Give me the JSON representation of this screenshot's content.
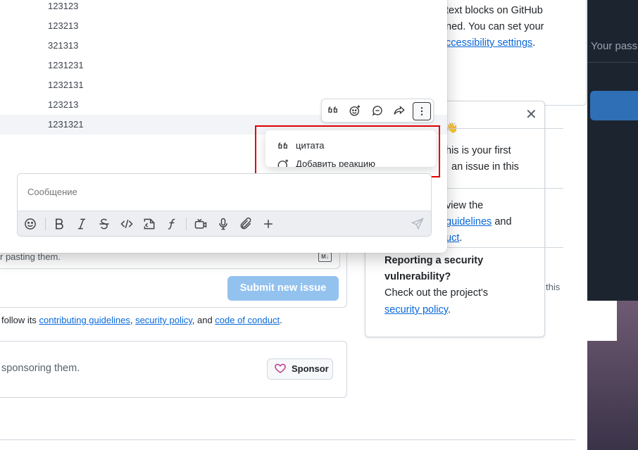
{
  "background": {
    "right_panel": {
      "password_label": "Your pass"
    },
    "top_card": {
      "line1": "text blocks on GitHub",
      "line2": "ned. You can set your",
      "link": "ccessibility settings",
      "link_suffix": "."
    },
    "tip_card": {
      "emoji": "👋",
      "line_a1": "his is your first",
      "line_a2": "an issue in this",
      "line_b1": "view the",
      "link_b": "guidelines",
      "line_b2_suffix": " and",
      "link_c": "uct",
      "line_c_suffix": ".",
      "security_heading1": "Reporting a security",
      "security_heading2": "vulnerability?",
      "security_text": "Check out the project's",
      "security_link": "security policy",
      "security_suffix": ".",
      "side_text": "this"
    },
    "issue_form": {
      "hint_text": "r pasting them.",
      "md_badge": "M↓",
      "submit_label": "Submit new issue"
    },
    "guidelines": {
      "prefix": "follow its ",
      "link1": "contributing guidelines",
      "sep1": ", ",
      "link2": "security policy",
      "sep2": ", and ",
      "link3": "code of conduct",
      "suffix": "."
    },
    "sponsor": {
      "text": "sponsoring them.",
      "button_label": "Sponsor"
    }
  },
  "chat": {
    "messages": [
      "123123",
      "123213",
      "321313",
      "1231231",
      "1232131",
      "123213",
      "1231321"
    ],
    "message_toolbar": {
      "actions": [
        "quote-icon",
        "add-reaction-icon",
        "reply-icon",
        "forward-icon",
        "more-options-icon"
      ]
    },
    "context_menu": {
      "items": [
        {
          "icon": "quote-icon",
          "label": "цитата"
        },
        {
          "icon": "add-reaction-icon",
          "label": "Добавить реакцию"
        }
      ]
    },
    "composer": {
      "placeholder": "Сообщение",
      "tools": [
        "emoji-icon",
        "bold-icon",
        "italic-icon",
        "strikethrough-icon",
        "code-icon",
        "code-block-icon",
        "formula-icon",
        "video-icon",
        "microphone-icon",
        "attachment-icon",
        "plus-icon",
        "send-icon"
      ]
    }
  },
  "colors": {
    "highlight": "#e00000",
    "link": "#0969da",
    "submit": "#94c2ee"
  }
}
